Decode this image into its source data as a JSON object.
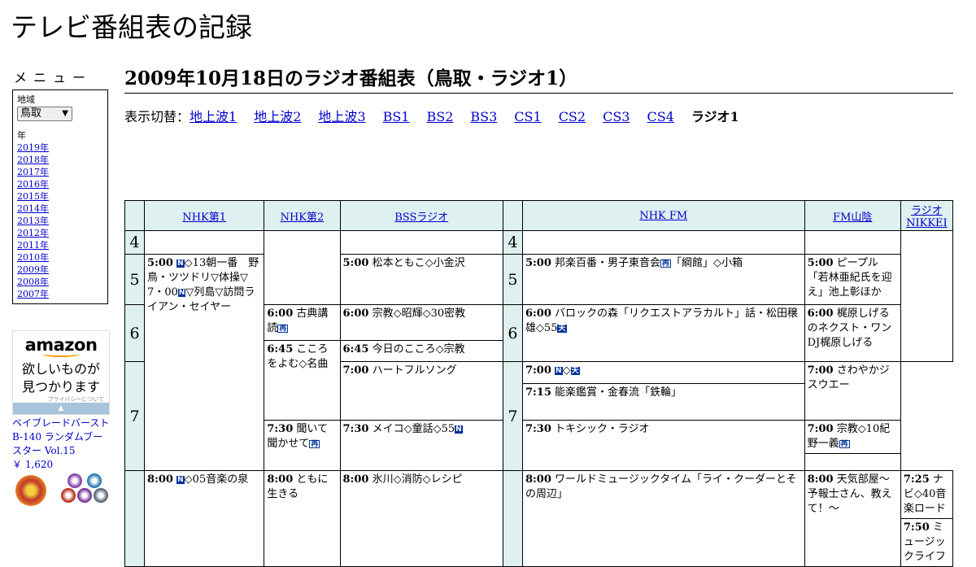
{
  "site_title": "テレビ番組表の記録",
  "sidebar": {
    "menu_heading": "メニュー",
    "region_label": "地域",
    "region_value": "鳥取",
    "year_label": "年",
    "years": [
      "2019年",
      "2018年",
      "2017年",
      "2016年",
      "2015年",
      "2014年",
      "2013年",
      "2012年",
      "2011年",
      "2010年",
      "2009年",
      "2008年",
      "2007年"
    ]
  },
  "ad": {
    "logo": "amazon",
    "copy_line1": "欲しいものが",
    "copy_line2": "見つかります",
    "privacy": "プライバシーについて",
    "product": "ベイブレードバーストB-140 ランダムブースター Vol.15",
    "price": "￥ 1,620"
  },
  "page_title": "2009年10月18日のラジオ番組表（鳥取・ラジオ1）",
  "switcher": {
    "label": "表示切替：",
    "links": [
      "地上波1",
      "地上波2",
      "地上波3",
      "BS1",
      "BS2",
      "BS3",
      "CS1",
      "CS2",
      "CS3",
      "CS4"
    ],
    "current": "ラジオ1"
  },
  "channels": [
    "NHK第1",
    "NHK第2",
    "BSSラジオ",
    "NHK FM",
    "FM山陰",
    "ラジオNIKKEI"
  ],
  "hours": [
    "4",
    "5",
    "6",
    "7"
  ],
  "marks": {
    "news": "N",
    "rebroadcast": "再",
    "weather": "天"
  },
  "programs": {
    "nhk1_500_time": "5:00",
    "nhk1_500_a": "◇13朝一番　野鳥・ツツドリ▽体操▽7・00",
    "nhk1_500_b": "▽列島▽訪問ライアン・セイヤー",
    "nhk1_800_time": "8:00",
    "nhk1_800_a": "◇05音楽の泉",
    "nhk2_600_time": "6:00",
    "nhk2_600": "古典講読",
    "nhk2_645_time": "6:45",
    "nhk2_645": "こころをよむ◇名曲",
    "nhk2_730_time": "7:30",
    "nhk2_730": "聞いて聞かせて",
    "nhk2_800_time": "8:00",
    "nhk2_800": "ともに生きる",
    "bss_500_time": "5:00",
    "bss_500": "松本ともこ◇小金沢",
    "bss_600_time": "6:00",
    "bss_600": "宗教◇昭輝◇30密教",
    "bss_645_time": "6:45",
    "bss_645": "今日のこころ◇宗教",
    "bss_700_time": "7:00",
    "bss_700": "ハートフルソング",
    "bss_730_time": "7:30",
    "bss_730": "メイコ◇童話◇55",
    "bss_800_time": "8:00",
    "bss_800": "氷川◇消防◇レシピ",
    "fm_500_time": "5:00",
    "fm_500_a": "邦楽百番・男子東音会",
    "fm_500_b": "「綱館」◇小箱",
    "fm_600_time": "6:00",
    "fm_600": "バロックの森「リクエストアラカルト」話・松田穣雄◇55",
    "fm_700_time": "7:00",
    "fm_700": "◇",
    "fm_715_time": "7:15",
    "fm_715": "能楽鑑賞・金春流「鉄輪」",
    "fm_800_time": "8:00",
    "fm_800": "ワールドミュージックタイム「ライ・クーダーとその周辺」",
    "fms_500_time": "5:00",
    "fms_500": "ピープル「若林亜紀氏を迎え」池上彰ほか",
    "fms_600_time": "6:00",
    "fms_600": "梶原しげるのネクスト・ワンDJ梶原しげる",
    "fms_700_time": "7:00",
    "fms_700": "さわやかジスウエー",
    "fms_730_time": "7:30",
    "fms_730": "トキシック・ラジオ",
    "fms_800_time": "8:00",
    "fms_800": "天気部屋～予報士さん、教えて！～",
    "nk_700_time": "7:00",
    "nk_700": "宗教◇10紀野一義",
    "nk_725_time": "7:25",
    "nk_725": "ナビ◇40音楽ロード",
    "nk_750_time": "7:50",
    "nk_750": "ミュージックライフ"
  }
}
